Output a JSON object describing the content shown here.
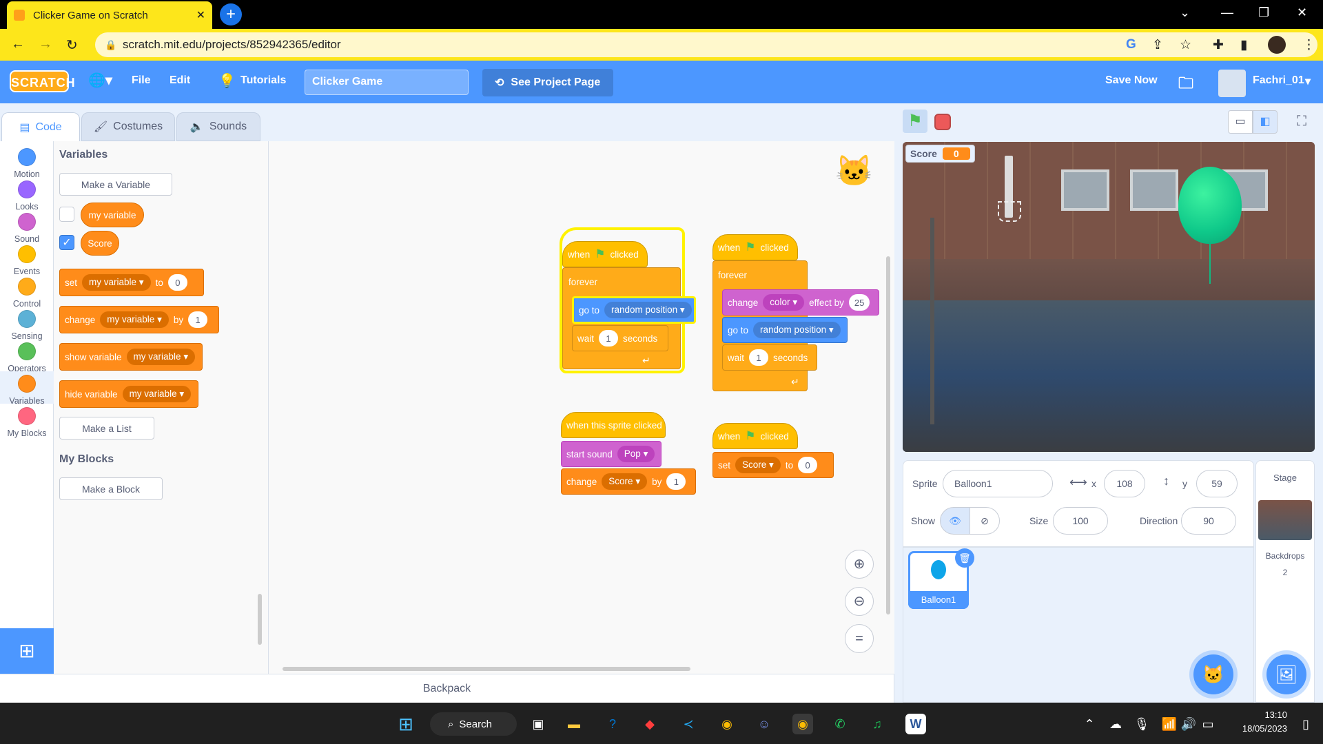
{
  "browser": {
    "tab_title": "Clicker Game on Scratch",
    "url": "scratch.mit.edu/projects/852942365/editor"
  },
  "menu": {
    "logo": "SCRATCH",
    "file": "File",
    "edit": "Edit",
    "tutorials": "Tutorials",
    "project_title": "Clicker Game",
    "see_project": "See Project Page",
    "save_now": "Save Now",
    "username": "Fachri_01"
  },
  "tabs": {
    "code": "Code",
    "costumes": "Costumes",
    "sounds": "Sounds"
  },
  "categories": [
    {
      "label": "Motion",
      "color": "#4c97ff"
    },
    {
      "label": "Looks",
      "color": "#9966ff"
    },
    {
      "label": "Sound",
      "color": "#cf63cf"
    },
    {
      "label": "Events",
      "color": "#ffbf00"
    },
    {
      "label": "Control",
      "color": "#ffab19"
    },
    {
      "label": "Sensing",
      "color": "#5cb1d6"
    },
    {
      "label": "Operators",
      "color": "#59c059"
    },
    {
      "label": "Variables",
      "color": "#ff8c1a"
    },
    {
      "label": "My Blocks",
      "color": "#ff6680"
    }
  ],
  "palette": {
    "variables_title": "Variables",
    "make_variable": "Make a Variable",
    "var1": "my variable",
    "var2": "Score",
    "set": "set",
    "to": "to",
    "set_val": "0",
    "change": "change",
    "by": "by",
    "change_val": "1",
    "show_variable": "show variable",
    "hide_variable": "hide variable",
    "make_list": "Make a List",
    "my_blocks_title": "My Blocks",
    "make_block": "Make a Block"
  },
  "scripts": {
    "when": "when",
    "clicked": "clicked",
    "forever": "forever",
    "go_to": "go to",
    "random_position": "random position",
    "wait": "wait",
    "wait_val": "1",
    "seconds": "seconds",
    "change": "change",
    "color": "color",
    "effect_by": "effect by",
    "effect_val": "25",
    "when_sprite_clicked": "when this sprite clicked",
    "start_sound": "start sound",
    "pop": "Pop",
    "score": "Score",
    "by": "by",
    "by_val": "1",
    "set": "set",
    "to": "to",
    "set_val": "0"
  },
  "backpack": "Backpack",
  "stage": {
    "monitor_label": "Score",
    "monitor_value": "0"
  },
  "sprite_info": {
    "sprite_label": "Sprite",
    "sprite_name": "Balloon1",
    "x_label": "x",
    "x_val": "108",
    "y_label": "y",
    "y_val": "59",
    "show_label": "Show",
    "size_label": "Size",
    "size_val": "100",
    "direction_label": "Direction",
    "direction_val": "90"
  },
  "sprite_list": {
    "thumb_name": "Balloon1"
  },
  "stage_pane": {
    "title": "Stage",
    "backdrops_label": "Backdrops",
    "backdrops_count": "2"
  },
  "taskbar": {
    "search": "Search",
    "time": "13:10",
    "date": "18/05/2023"
  }
}
